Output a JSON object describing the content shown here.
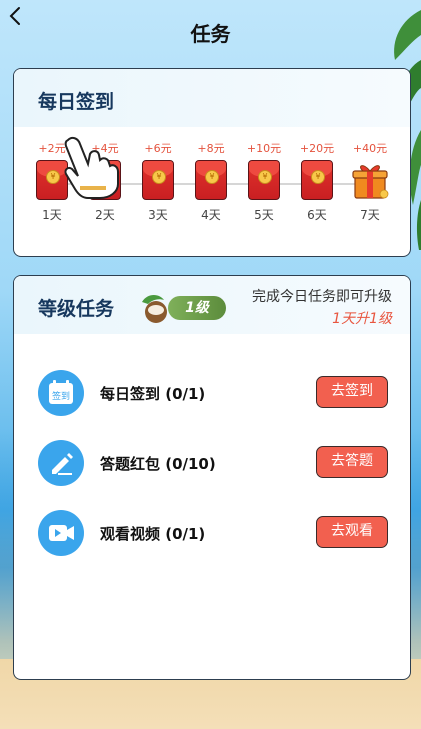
{
  "header": {
    "title": "任务"
  },
  "checkin": {
    "title": "每日签到",
    "days": [
      {
        "reward": "+2元",
        "label": "1天"
      },
      {
        "reward": "+4元",
        "label": "2天"
      },
      {
        "reward": "+6元",
        "label": "3天"
      },
      {
        "reward": "+8元",
        "label": "4天"
      },
      {
        "reward": "+10元",
        "label": "5天"
      },
      {
        "reward": "+20元",
        "label": "6天"
      },
      {
        "reward": "+40元",
        "label": "7天"
      }
    ]
  },
  "level_tasks": {
    "title": "等级任务",
    "level": "1级",
    "hint": "完成今日任务即可升级",
    "days_to_upgrade": "1天升1级",
    "items": [
      {
        "name": "每日签到  (0/1)",
        "button": "去签到",
        "icon": "calendar-checkin-icon",
        "icon_text": "签到"
      },
      {
        "name": "答题红包  (0/10)",
        "button": "去答题",
        "icon": "pencil-icon"
      },
      {
        "name": "观看视频  (0/1)",
        "button": "去观看",
        "icon": "video-camera-icon"
      }
    ]
  },
  "colors": {
    "accent": "#3aa5ec",
    "button": "#f2604f",
    "reward": "#e4533e",
    "title": "#17385e"
  }
}
